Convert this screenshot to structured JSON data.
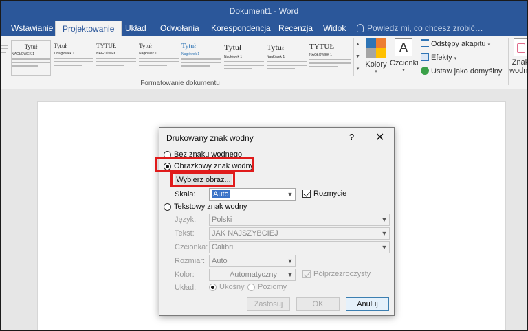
{
  "window": {
    "title": "Dokument1 - Word"
  },
  "tabs": [
    {
      "label": "Wstawianie",
      "active": false
    },
    {
      "label": "Projektowanie",
      "active": true
    },
    {
      "label": "Układ",
      "active": false
    },
    {
      "label": "Odwołania",
      "active": false
    },
    {
      "label": "Korespondencja",
      "active": false
    },
    {
      "label": "Recenzja",
      "active": false
    },
    {
      "label": "Widok",
      "active": false
    }
  ],
  "tell_me": "Powiedz mi, co chcesz zrobić…",
  "ribbon": {
    "gallery": [
      {
        "title": "Tytuł",
        "heading": "NAGŁÓWEK 1"
      },
      {
        "title": "Tytuł",
        "heading": "1 Nagłówek 1"
      },
      {
        "title": "TYTUŁ",
        "heading": "NAGŁÓWEK 1"
      },
      {
        "title": "Tytuł",
        "heading": "Nagłówek 1"
      },
      {
        "title": "Tytuł",
        "heading": "Nagłówek 1"
      },
      {
        "title": "Tytuł",
        "heading": "Nagłówek 1"
      },
      {
        "title": "Tytuł",
        "heading": "Nagłówek 1"
      },
      {
        "title": "TYTUŁ",
        "heading": "NAGŁÓWEK 1"
      }
    ],
    "colors_label": "Kolory",
    "fonts_label": "Czcionki",
    "paragraph_spacing": "Odstępy akapitu",
    "effects": "Efekty",
    "set_default": "Ustaw jako domyślny",
    "watermark_label_1": "Znak",
    "watermark_label_2": "wodny",
    "group_label": "Formatowanie dokumentu",
    "accent_colors": [
      "#2e74b5",
      "#ed7d31",
      "#a5a5a5",
      "#ffc000"
    ]
  },
  "dialog": {
    "title": "Drukowany znak wodny",
    "help": "?",
    "close": "✕",
    "no_watermark": "Bez znaku wodnego",
    "picture_watermark": "Obrazkowy znak wodny",
    "select_picture": "Wybierz obraz...",
    "scale_label": "Skala:",
    "scale_value": "Auto",
    "washout": "Rozmycie",
    "text_watermark": "Tekstowy znak wodny",
    "language_label": "Język:",
    "language_value": "Polski",
    "text_label": "Tekst:",
    "text_value": "JAK NAJSZYBCIEJ",
    "font_label": "Czcionka:",
    "font_value": "Calibri",
    "size_label": "Rozmiar:",
    "size_value": "Auto",
    "color_label": "Kolor:",
    "color_value": "Automatyczny",
    "semitransparent": "Półprzezroczysty",
    "layout_label": "Układ:",
    "diagonal": "Ukośny",
    "horizontal": "Poziomy",
    "apply": "Zastosuj",
    "ok": "OK",
    "cancel": "Anuluj",
    "highlight_color": "#e01b1b"
  }
}
